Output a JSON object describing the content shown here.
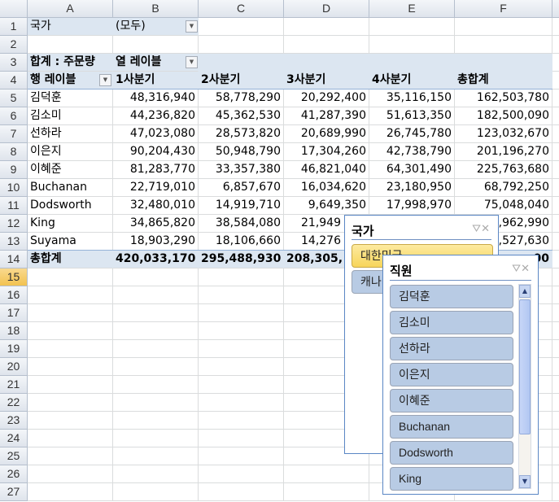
{
  "columns": [
    "A",
    "B",
    "C",
    "D",
    "E",
    "F"
  ],
  "row_numbers": [
    "1",
    "2",
    "3",
    "4",
    "5",
    "6",
    "7",
    "8",
    "9",
    "10",
    "11",
    "12",
    "13",
    "14",
    "15",
    "16",
    "17",
    "18",
    "19",
    "20",
    "21",
    "22",
    "23",
    "24",
    "25",
    "26",
    "27"
  ],
  "active_row": "15",
  "pivot": {
    "filter_label": "국가",
    "filter_value": "(모두)",
    "value_label": "합계 : 주문량",
    "col_labels": "열 레이블",
    "row_labels": "행 레이블",
    "headers": [
      "1사분기",
      "2사분기",
      "3사분기",
      "4사분기",
      "총합계"
    ],
    "rows": [
      {
        "name": "김덕훈",
        "values": [
          "48,316,940",
          "58,778,290",
          "20,292,400",
          "35,116,150",
          "162,503,780"
        ]
      },
      {
        "name": "김소미",
        "values": [
          "44,236,820",
          "45,362,530",
          "41,287,390",
          "51,613,350",
          "182,500,090"
        ]
      },
      {
        "name": "선하라",
        "values": [
          "47,023,080",
          "28,573,820",
          "20,689,990",
          "26,745,780",
          "123,032,670"
        ]
      },
      {
        "name": "이은지",
        "values": [
          "90,204,430",
          "50,948,790",
          "17,304,260",
          "42,738,790",
          "201,196,270"
        ]
      },
      {
        "name": "이혜준",
        "values": [
          "81,283,770",
          "33,357,380",
          "46,821,040",
          "64,301,490",
          "225,763,680"
        ]
      },
      {
        "name": "Buchanan",
        "values": [
          "22,719,010",
          "6,857,670",
          "16,034,620",
          "23,180,950",
          "68,792,250"
        ]
      },
      {
        "name": "Dodsworth",
        "values": [
          "32,480,010",
          "14,919,710",
          "9,649,350",
          "17,998,970",
          "75,048,040"
        ]
      },
      {
        "name": "King",
        "values": [
          "34,865,820",
          "38,584,080",
          "21,949",
          "",
          "6,962,990"
        ]
      },
      {
        "name": "Suyama",
        "values": [
          "18,903,290",
          "18,106,660",
          "14,276",
          "",
          "2,527,630"
        ]
      }
    ],
    "total": {
      "name": "총합계",
      "values": [
        "420,033,170",
        "295,488,930",
        "208,305,",
        "",
        "00"
      ]
    }
  },
  "slicer_country": {
    "title": "국가",
    "items": [
      "대한민국",
      "캐나다"
    ],
    "selected": "대한민국"
  },
  "slicer_employee": {
    "title": "직원",
    "items": [
      "김덕훈",
      "김소미",
      "선하라",
      "이은지",
      "이혜준",
      "Buchanan",
      "Dodsworth",
      "King"
    ]
  },
  "colors": {
    "band": "#dce6f1",
    "slicer_item": "#b8cbe4",
    "slicer_selected": "#f7d55a",
    "active_row_header": "#f2c24f"
  }
}
